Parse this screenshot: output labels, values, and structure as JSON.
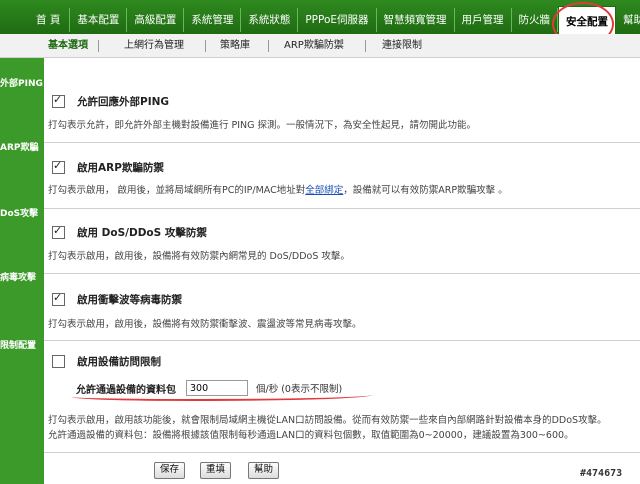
{
  "top_nav": [
    {
      "label": "首 頁"
    },
    {
      "label": "基本配置"
    },
    {
      "label": "高級配置"
    },
    {
      "label": "系統管理"
    },
    {
      "label": "系統狀態"
    },
    {
      "label": "PPPoE伺服器"
    },
    {
      "label": "智慧頻寬管理"
    },
    {
      "label": "用戶管理"
    },
    {
      "label": "防火牆"
    },
    {
      "label": "安全配置"
    },
    {
      "label": "幫助"
    }
  ],
  "sub_nav": [
    "基本選項",
    "上網行為管理",
    "策略庫",
    "ARP欺騙防禦",
    "連接限制"
  ],
  "sidebar": [
    "外部PING",
    "ARP欺騙",
    "DoS攻擊",
    "病毒攻擊",
    "限制配置"
  ],
  "ping": {
    "checked": true,
    "label": "允許回應外部PING",
    "desc": "打勾表示允許，即允許外部主機對設備進行 PING 探測。一般情況下，為安全性起見，請勿開此功能。"
  },
  "arp": {
    "checked": true,
    "label": "啟用ARP欺騙防禦",
    "desc_before": "打勾表示啟用，  啟用後，並將局域網所有PC的IP/MAC地址對",
    "desc_link": "全部綁定",
    "desc_after": "，設備就可以有效防禦ARP欺騙攻擊 。"
  },
  "dos": {
    "checked": true,
    "label": "啟用  DoS/DDoS 攻擊防禦",
    "desc": "打勾表示啟用，啟用後，設備將有效防禦內網常見的  DoS/DDoS 攻擊。"
  },
  "virus": {
    "checked": true,
    "label": "啟用衝擊波等病毒防禦",
    "desc": "打勾表示啟用，啟用後，設備將有效防禦衝擊波、震盪波等常見病毒攻擊。"
  },
  "limit": {
    "checked": false,
    "label": "啟用設備訪問限制",
    "rate_label": "允許通過設備的資料包",
    "rate_value": "300",
    "rate_unit": "個/秒  (0表示不限制)",
    "desc1": "打勾表示啟用，啟用該功能後，就會限制局域網主機從LAN口訪問設備。從而有效防禦一些來自內部網路針對設備本身的DDoS攻擊。",
    "desc2": "允許通過設備的資料包：設備將根據該值限制每秒通過LAN口的資料包個數，取值範圍為0~20000，建議設置為300~600。"
  },
  "buttons": {
    "save": "保存",
    "reset": "重填",
    "help": "幫助"
  },
  "watermark": "#474673",
  "colors": {
    "nav_green": "#2f8a1f",
    "sidebar_green": "#3b9a2a",
    "annotation_red": "#e23a3a",
    "link_blue": "#1a4fb5"
  }
}
